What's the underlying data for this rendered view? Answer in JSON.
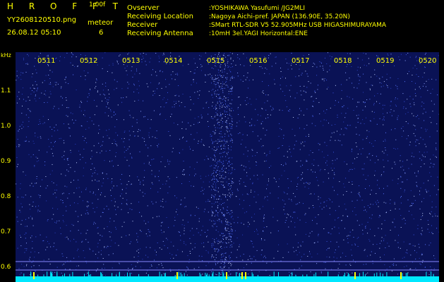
{
  "header": {
    "app_title": "H R O F F T",
    "version": "1.00f",
    "filename": "YY2608120510.png",
    "meteor_label": "meteor",
    "datetime": "26.08.12 05:10",
    "meteor_count": "6",
    "info": [
      {
        "label": "Ovserver",
        "value": ":YOSHIKAWA Yasufumi /JG2MLI"
      },
      {
        "label": "Receiving Location",
        "value": ":Nagoya Aichi-pref. JAPAN (136.90E, 35.20N)"
      },
      {
        "label": "Receiver",
        "value": ":SMart RTL-SDR V5 52.905MHz USB HIGASHIMURAYAMA"
      },
      {
        "label": "Receiving Antenna",
        "value": ":10mH 3el.YAGI Horizontal:ENE"
      }
    ]
  },
  "axis": {
    "unit": "kHz",
    "y_ticks": [
      "1.1",
      "1.0",
      "0.9",
      "0.8",
      "0.7",
      "0.6"
    ],
    "x_ticks": [
      "0511",
      "0512",
      "0513",
      "0514",
      "0515",
      "0516",
      "0517",
      "0518",
      "0519",
      "0520"
    ]
  },
  "colors": {
    "background": "#000000",
    "spectrogram_bg": "#0a1255",
    "text": "#ffff00",
    "baseline": "#00e8ff",
    "guide": "#8888ff"
  }
}
